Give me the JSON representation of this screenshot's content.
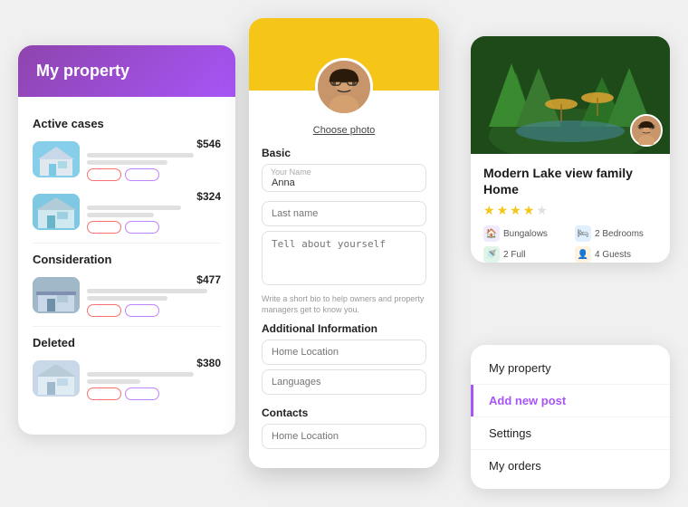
{
  "leftCard": {
    "title": "My property",
    "sections": [
      {
        "label": "Active cases",
        "items": [
          {
            "price": "$546",
            "thumbClass": "t1"
          },
          {
            "price": "$324",
            "thumbClass": "t2"
          }
        ]
      },
      {
        "label": "Consideration",
        "items": [
          {
            "price": "$477",
            "thumbClass": "t3"
          }
        ]
      },
      {
        "label": "Deleted",
        "items": [
          {
            "price": "$380",
            "thumbClass": "t4"
          }
        ]
      }
    ]
  },
  "centerCard": {
    "choosePhoto": "Choose photo",
    "basicLabel": "Basic",
    "fields": {
      "yourName": {
        "label": "Your Name",
        "value": "Anna"
      },
      "lastName": {
        "placeholder": "Last name"
      },
      "tellAbout": {
        "placeholder": "Tell about yourself"
      }
    },
    "hint": "Write a short bio to help owners and property managers get to know you.",
    "additionalLabel": "Additional Information",
    "homeLocation": {
      "placeholder": "Home Location"
    },
    "languages": {
      "placeholder": "Languages"
    },
    "contactsLabel": "Contacts",
    "contactHomeLocation": {
      "placeholder": "Home Location"
    }
  },
  "rightCard": {
    "title": "Modern Lake view family Home",
    "stars": [
      1,
      1,
      1,
      1,
      0
    ],
    "meta": [
      {
        "iconType": "purple",
        "label": "Bungalows"
      },
      {
        "iconType": "blue",
        "label": "2 Bedrooms"
      },
      {
        "iconType": "green",
        "label": "2 Full"
      },
      {
        "iconType": "orange",
        "label": "4 Guests"
      }
    ]
  },
  "menuCard": {
    "items": [
      {
        "label": "My property",
        "active": false
      },
      {
        "label": "Add new post",
        "active": true
      },
      {
        "label": "Settings",
        "active": false
      },
      {
        "label": "My orders",
        "active": false
      }
    ]
  },
  "icons": {
    "house": "🏠",
    "bed": "🛏",
    "bath": "🚿",
    "person": "👤"
  }
}
